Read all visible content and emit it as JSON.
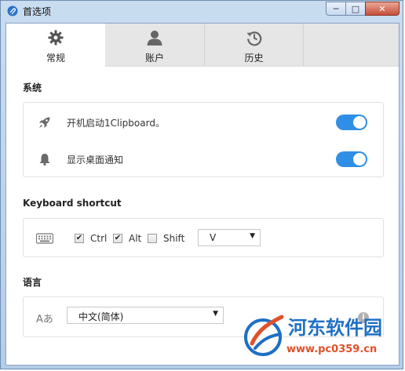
{
  "window": {
    "title": "首选项",
    "minimize_glyph": "─",
    "maximize_glyph": "□",
    "close_glyph": "✕"
  },
  "tabs": [
    {
      "label": "常规",
      "icon": "gear-icon",
      "active": true
    },
    {
      "label": "账户",
      "icon": "user-icon",
      "active": false
    },
    {
      "label": "历史",
      "icon": "history-icon",
      "active": false
    }
  ],
  "system": {
    "title": "系统",
    "items": [
      {
        "label": "开机启动1Clipboard。",
        "icon": "rocket-icon",
        "enabled": true
      },
      {
        "label": "显示桌面通知",
        "icon": "bell-icon",
        "enabled": true
      }
    ]
  },
  "keyboard": {
    "title": "Keyboard shortcut",
    "icon": "keyboard-icon",
    "modifiers": [
      {
        "label": "Ctrl",
        "checked": true
      },
      {
        "label": "Alt",
        "checked": true
      },
      {
        "label": "Shift",
        "checked": false
      }
    ],
    "key_value": "V",
    "check_glyph": "✔",
    "dropdown_glyph": "▼"
  },
  "language": {
    "title": "语言",
    "icon": "translate-icon",
    "icon_text": "Aあ",
    "value": "中文(简体)",
    "info_glyph": "i"
  },
  "watermark": {
    "line1": "河东软件园",
    "line2": "www.pc0359.cn"
  },
  "colors": {
    "toggle_on": "#2f8fe6",
    "tab_bar": "#e6e6e6",
    "titlebar": "#b4cde8",
    "watermark_blue": "#1f6fc4",
    "watermark_red": "#e0502b"
  }
}
